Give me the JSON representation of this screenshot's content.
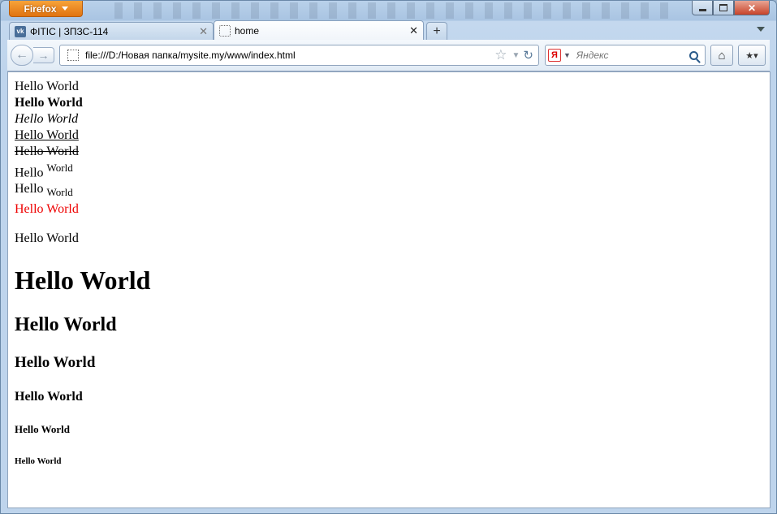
{
  "app": {
    "button_label": "Firefox"
  },
  "tabs": [
    {
      "label": "ФІТІС | ЗПЗС-114",
      "favicon": "vk-icon"
    },
    {
      "label": "home",
      "favicon": "blank-page-icon"
    }
  ],
  "nav": {
    "url": "file:///D:/Новая папка/mysite.my/www/index.html",
    "search_placeholder": "Яндекс",
    "search_engine_letter": "Я"
  },
  "content": {
    "plain": "Hello World",
    "bold": "Hello World",
    "italic": "Hello World",
    "underline": "Hello World",
    "strike": "Hello World",
    "sup_base": "Hello",
    "sup_text": "World",
    "sub_base": "Hello",
    "sub_text": "World",
    "red": "Hello World",
    "paragraph": "Hello World",
    "h1": "Hello World",
    "h2": "Hello World",
    "h3": "Hello World",
    "h4": "Hello World",
    "h5": "Hello World",
    "h6": "Hello World"
  },
  "colors": {
    "red_text": "#e00000",
    "firefox_orange": "#e88a1e"
  }
}
